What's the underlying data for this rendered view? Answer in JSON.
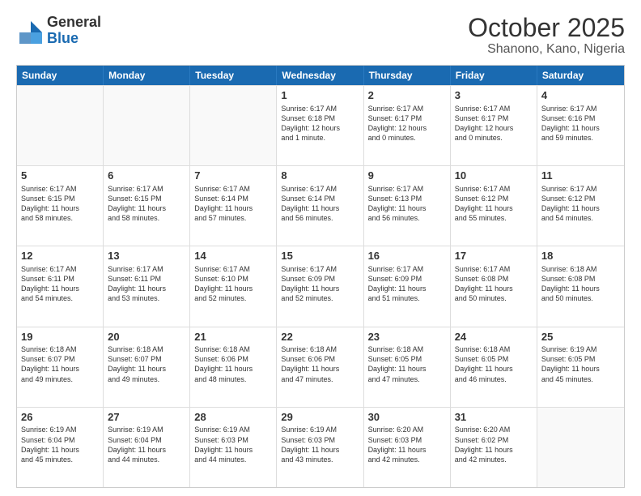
{
  "header": {
    "logo_general": "General",
    "logo_blue": "Blue",
    "month": "October 2025",
    "location": "Shanono, Kano, Nigeria"
  },
  "weekdays": [
    "Sunday",
    "Monday",
    "Tuesday",
    "Wednesday",
    "Thursday",
    "Friday",
    "Saturday"
  ],
  "rows": [
    [
      {
        "day": "",
        "info": ""
      },
      {
        "day": "",
        "info": ""
      },
      {
        "day": "",
        "info": ""
      },
      {
        "day": "1",
        "info": "Sunrise: 6:17 AM\nSunset: 6:18 PM\nDaylight: 12 hours\nand 1 minute."
      },
      {
        "day": "2",
        "info": "Sunrise: 6:17 AM\nSunset: 6:17 PM\nDaylight: 12 hours\nand 0 minutes."
      },
      {
        "day": "3",
        "info": "Sunrise: 6:17 AM\nSunset: 6:17 PM\nDaylight: 12 hours\nand 0 minutes."
      },
      {
        "day": "4",
        "info": "Sunrise: 6:17 AM\nSunset: 6:16 PM\nDaylight: 11 hours\nand 59 minutes."
      }
    ],
    [
      {
        "day": "5",
        "info": "Sunrise: 6:17 AM\nSunset: 6:15 PM\nDaylight: 11 hours\nand 58 minutes."
      },
      {
        "day": "6",
        "info": "Sunrise: 6:17 AM\nSunset: 6:15 PM\nDaylight: 11 hours\nand 58 minutes."
      },
      {
        "day": "7",
        "info": "Sunrise: 6:17 AM\nSunset: 6:14 PM\nDaylight: 11 hours\nand 57 minutes."
      },
      {
        "day": "8",
        "info": "Sunrise: 6:17 AM\nSunset: 6:14 PM\nDaylight: 11 hours\nand 56 minutes."
      },
      {
        "day": "9",
        "info": "Sunrise: 6:17 AM\nSunset: 6:13 PM\nDaylight: 11 hours\nand 56 minutes."
      },
      {
        "day": "10",
        "info": "Sunrise: 6:17 AM\nSunset: 6:12 PM\nDaylight: 11 hours\nand 55 minutes."
      },
      {
        "day": "11",
        "info": "Sunrise: 6:17 AM\nSunset: 6:12 PM\nDaylight: 11 hours\nand 54 minutes."
      }
    ],
    [
      {
        "day": "12",
        "info": "Sunrise: 6:17 AM\nSunset: 6:11 PM\nDaylight: 11 hours\nand 54 minutes."
      },
      {
        "day": "13",
        "info": "Sunrise: 6:17 AM\nSunset: 6:11 PM\nDaylight: 11 hours\nand 53 minutes."
      },
      {
        "day": "14",
        "info": "Sunrise: 6:17 AM\nSunset: 6:10 PM\nDaylight: 11 hours\nand 52 minutes."
      },
      {
        "day": "15",
        "info": "Sunrise: 6:17 AM\nSunset: 6:09 PM\nDaylight: 11 hours\nand 52 minutes."
      },
      {
        "day": "16",
        "info": "Sunrise: 6:17 AM\nSunset: 6:09 PM\nDaylight: 11 hours\nand 51 minutes."
      },
      {
        "day": "17",
        "info": "Sunrise: 6:17 AM\nSunset: 6:08 PM\nDaylight: 11 hours\nand 50 minutes."
      },
      {
        "day": "18",
        "info": "Sunrise: 6:18 AM\nSunset: 6:08 PM\nDaylight: 11 hours\nand 50 minutes."
      }
    ],
    [
      {
        "day": "19",
        "info": "Sunrise: 6:18 AM\nSunset: 6:07 PM\nDaylight: 11 hours\nand 49 minutes."
      },
      {
        "day": "20",
        "info": "Sunrise: 6:18 AM\nSunset: 6:07 PM\nDaylight: 11 hours\nand 49 minutes."
      },
      {
        "day": "21",
        "info": "Sunrise: 6:18 AM\nSunset: 6:06 PM\nDaylight: 11 hours\nand 48 minutes."
      },
      {
        "day": "22",
        "info": "Sunrise: 6:18 AM\nSunset: 6:06 PM\nDaylight: 11 hours\nand 47 minutes."
      },
      {
        "day": "23",
        "info": "Sunrise: 6:18 AM\nSunset: 6:05 PM\nDaylight: 11 hours\nand 47 minutes."
      },
      {
        "day": "24",
        "info": "Sunrise: 6:18 AM\nSunset: 6:05 PM\nDaylight: 11 hours\nand 46 minutes."
      },
      {
        "day": "25",
        "info": "Sunrise: 6:19 AM\nSunset: 6:05 PM\nDaylight: 11 hours\nand 45 minutes."
      }
    ],
    [
      {
        "day": "26",
        "info": "Sunrise: 6:19 AM\nSunset: 6:04 PM\nDaylight: 11 hours\nand 45 minutes."
      },
      {
        "day": "27",
        "info": "Sunrise: 6:19 AM\nSunset: 6:04 PM\nDaylight: 11 hours\nand 44 minutes."
      },
      {
        "day": "28",
        "info": "Sunrise: 6:19 AM\nSunset: 6:03 PM\nDaylight: 11 hours\nand 44 minutes."
      },
      {
        "day": "29",
        "info": "Sunrise: 6:19 AM\nSunset: 6:03 PM\nDaylight: 11 hours\nand 43 minutes."
      },
      {
        "day": "30",
        "info": "Sunrise: 6:20 AM\nSunset: 6:03 PM\nDaylight: 11 hours\nand 42 minutes."
      },
      {
        "day": "31",
        "info": "Sunrise: 6:20 AM\nSunset: 6:02 PM\nDaylight: 11 hours\nand 42 minutes."
      },
      {
        "day": "",
        "info": ""
      }
    ]
  ]
}
